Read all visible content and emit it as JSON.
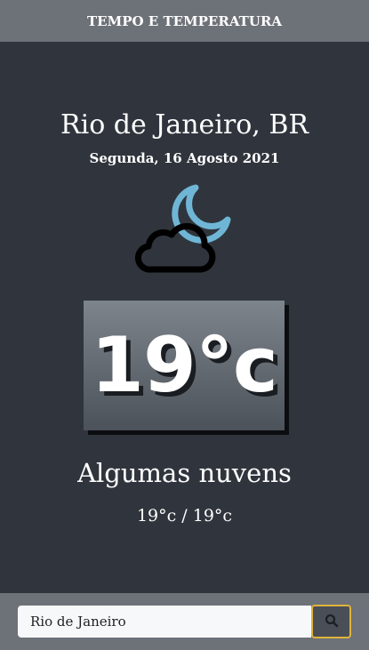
{
  "app": {
    "title": "TEMPO E TEMPERATURA"
  },
  "weather": {
    "city": "Rio de Janeiro, BR",
    "date": "Segunda, 16 Agosto 2021",
    "icon": "cloud-moon-icon",
    "temperature": "19°c",
    "description": "Algumas nuvens",
    "min_max": "19°c / 19°c"
  },
  "search": {
    "value": "Rio de Janeiro",
    "button_icon": "search-icon"
  },
  "colors": {
    "background": "#30353d",
    "bars": "#6d7278",
    "moon": "#6fb6d6",
    "button_border": "#e0b23b"
  }
}
